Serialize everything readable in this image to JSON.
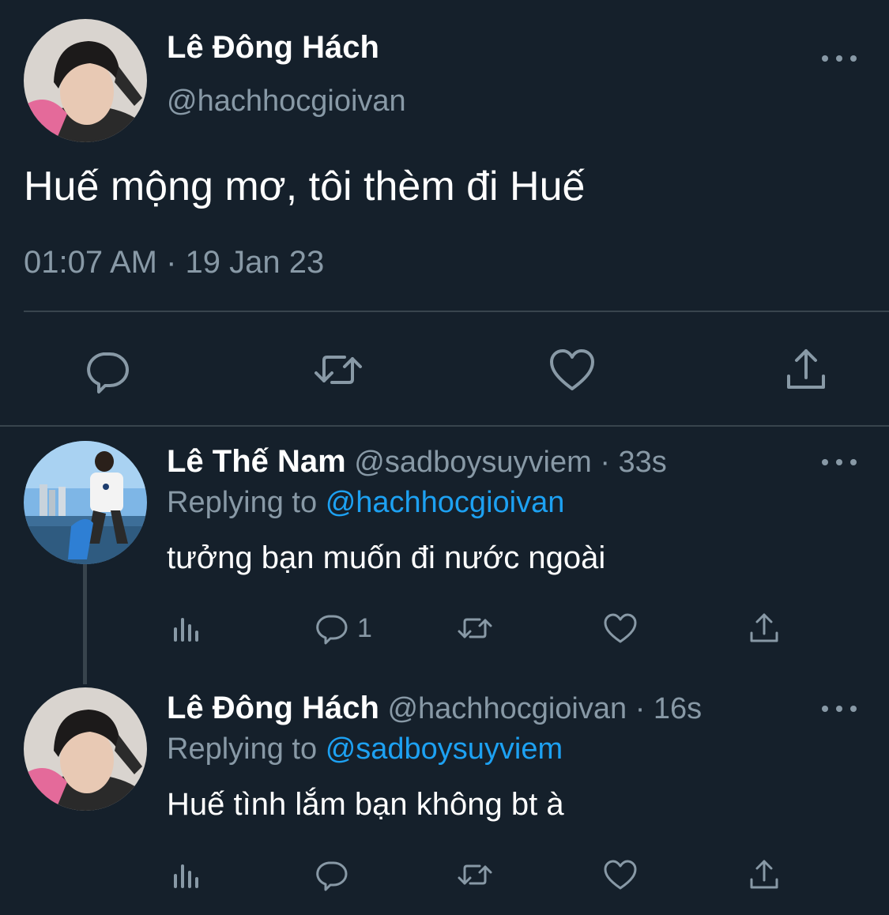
{
  "colors": {
    "background": "#15202b",
    "text_primary": "#ffffff",
    "text_secondary": "#8899a6",
    "link": "#1da1f2",
    "divider": "#38444d"
  },
  "main_tweet": {
    "author_name": "Lê Đông Hách",
    "author_handle": "@hachhocgioivan",
    "text": "Huế mộng mơ, tôi thèm đi Huế",
    "timestamp": "01:07 AM · 19 Jan 23",
    "actions": {
      "reply_icon": "reply-icon",
      "retweet_icon": "retweet-icon",
      "like_icon": "like-icon",
      "share_icon": "share-icon"
    },
    "more_icon": "more-icon"
  },
  "replies": [
    {
      "author_name": "Lê Thế Nam",
      "author_handle": "@sadboysuyviem",
      "time_ago": "· 33s",
      "replying_label": "Replying to",
      "replying_to": "@hachhocgioivan",
      "text": "tưởng bạn muốn đi nước ngoài",
      "reply_count": "1"
    },
    {
      "author_name": "Lê Đông Hách",
      "author_handle": "@hachhocgioivan",
      "time_ago": "· 16s",
      "replying_label": "Replying to",
      "replying_to": "@sadboysuyviem",
      "text": "Huế tình lắm bạn không bt à",
      "reply_count": ""
    }
  ]
}
